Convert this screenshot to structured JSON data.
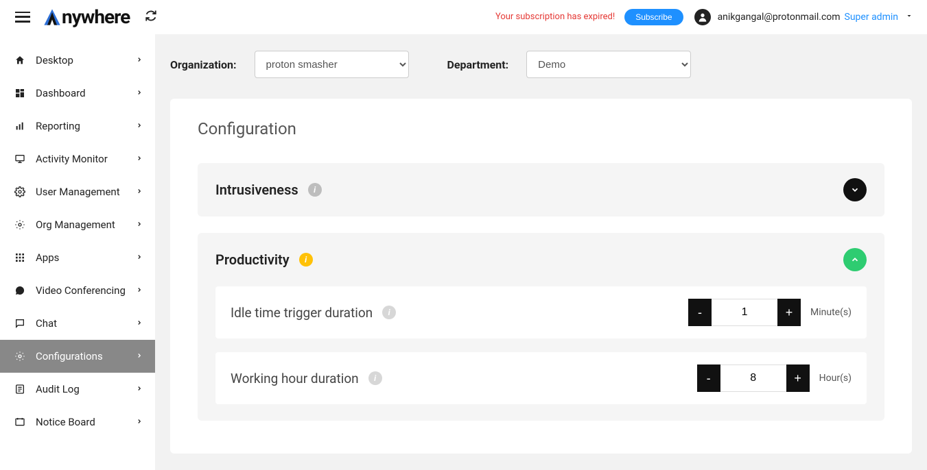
{
  "header": {
    "logo_text": "nywhere",
    "subscription_warning": "Your subscription has expired!",
    "subscribe_label": "Subscribe",
    "user_email": "anikgangal@protonmail.com",
    "role_label": "Super admin"
  },
  "sidebar": {
    "items": [
      {
        "label": "Desktop",
        "icon": "home"
      },
      {
        "label": "Dashboard",
        "icon": "dashboard"
      },
      {
        "label": "Reporting",
        "icon": "bars"
      },
      {
        "label": "Activity Monitor",
        "icon": "monitor"
      },
      {
        "label": "User Management",
        "icon": "gear"
      },
      {
        "label": "Org Management",
        "icon": "gear"
      },
      {
        "label": "Apps",
        "icon": "grid"
      },
      {
        "label": "Video Conferencing",
        "icon": "chat-round"
      },
      {
        "label": "Chat",
        "icon": "chat-square"
      },
      {
        "label": "Configurations",
        "icon": "gear",
        "active": true
      },
      {
        "label": "Audit Log",
        "icon": "log"
      },
      {
        "label": "Notice Board",
        "icon": "board"
      }
    ]
  },
  "filters": {
    "organization_label": "Organization:",
    "organization_value": "proton smasher",
    "department_label": "Department:",
    "department_value": "Demo"
  },
  "config": {
    "title": "Configuration",
    "sections": {
      "intrusiveness": {
        "title": "Intrusiveness"
      },
      "productivity": {
        "title": "Productivity",
        "idle": {
          "label": "Idle time trigger duration",
          "value": "1",
          "unit": "Minute(s)"
        },
        "working": {
          "label": "Working hour duration",
          "value": "8",
          "unit": "Hour(s)"
        }
      }
    }
  }
}
